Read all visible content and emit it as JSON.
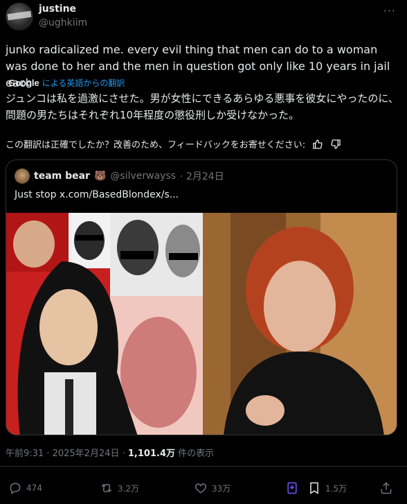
{
  "author": {
    "display_name": "justine",
    "handle": "@ughkiim"
  },
  "tweet": {
    "text": "junko radicalized me. every evil thing that men can do to a woman was done to her and the men in question got only like 10 years in jail each",
    "google_label": "Google",
    "translation_link": "による英語からの翻訳",
    "translated_text": "ジュンコは私を過激にさせた。男が女性にできるあらゆる悪事を彼女にやったのに、問題の男たちはそれぞれ10年程度の懲役刑しか受けなかった。",
    "feedback_prompt": "この翻訳は正確でしたか？改善のため、フィードバックをお寄せください:"
  },
  "quoted": {
    "display_name": "team bear",
    "emoji": "🐻",
    "handle": "@silverwayss",
    "date": "· 2月24日",
    "text": "Just stop  x.com/BasedBlondex/s..."
  },
  "meta": {
    "time": "午前9:31 · 2025年2月24日 · ",
    "views": "1,101.4万",
    "views_suffix": " 件の表示"
  },
  "actions": {
    "replies": "474",
    "reposts": "3.2万",
    "likes": "33万",
    "bookmarks": "1.5万"
  },
  "colors": {
    "background": "#000000",
    "text": "#e7e9ea",
    "muted": "#71767b",
    "link": "#1d9bf0",
    "grok": "#7856ff",
    "border": "#2f3336"
  },
  "icons": [
    "more-icon",
    "thumbs-up-icon",
    "thumbs-down-icon",
    "reply-icon",
    "repost-icon",
    "like-icon",
    "grok-icon",
    "bookmark-icon",
    "share-icon"
  ]
}
